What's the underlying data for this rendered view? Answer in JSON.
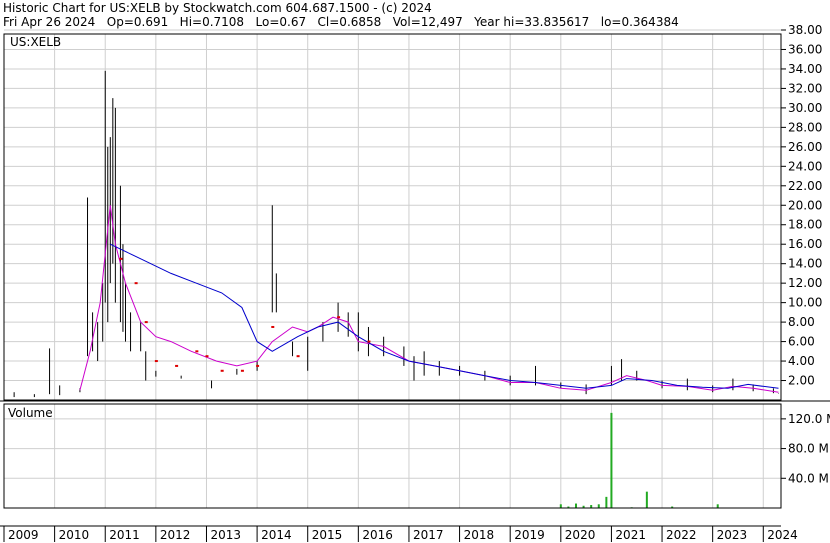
{
  "header": {
    "line1": "Historic Chart for US:XELB by Stockwatch.com 604.687.1500 - (c) 2024",
    "line2": "Fri Apr 26 2024   Op=0.691   Hi=0.7108   Lo=0.67   Cl=0.6858   Vol=12,497   Year hi=33.835617   lo=0.364384"
  },
  "colors": {
    "background": "#ffffff",
    "grid": "#cfcfcf",
    "price_bar": "#000000",
    "ma_short": "#cc00cc",
    "ma_long": "#0000cc",
    "red_marks": "#dd0000",
    "volume": "#22aa22"
  },
  "chart_data": [
    {
      "type": "line",
      "title": "US:XELB",
      "ylim": [
        0,
        38
      ],
      "yticks": [
        "38.00",
        "36.00",
        "34.00",
        "32.00",
        "30.00",
        "28.00",
        "26.00",
        "24.00",
        "22.00",
        "20.00",
        "18.00",
        "16.00",
        "14.00",
        "12.00",
        "10.00",
        "8.00",
        "6.00",
        "4.00",
        "2.00"
      ],
      "grid": true,
      "x_labels": [
        "2009",
        "2010",
        "2011",
        "2012",
        "2013",
        "2014",
        "2015",
        "2016",
        "2017",
        "2018",
        "2019",
        "2020",
        "2021",
        "2022",
        "2023",
        "2024"
      ],
      "price_bars": [
        {
          "x": 2009.2,
          "hi": 0.8,
          "lo": 0.3
        },
        {
          "x": 2009.6,
          "hi": 0.6,
          "lo": 0.3
        },
        {
          "x": 2009.9,
          "hi": 5.3,
          "lo": 0.6
        },
        {
          "x": 2010.1,
          "hi": 1.5,
          "lo": 0.5
        },
        {
          "x": 2010.5,
          "hi": 1.2,
          "lo": 0.8
        },
        {
          "x": 2010.65,
          "hi": 20.8,
          "lo": 4.5
        },
        {
          "x": 2010.75,
          "hi": 9.0,
          "lo": 5.0
        },
        {
          "x": 2010.85,
          "hi": 8.0,
          "lo": 4.0
        },
        {
          "x": 2010.95,
          "hi": 12.0,
          "lo": 6.0
        },
        {
          "x": 2011.0,
          "hi": 33.8,
          "lo": 10.0
        },
        {
          "x": 2011.05,
          "hi": 26.0,
          "lo": 8.0
        },
        {
          "x": 2011.1,
          "hi": 27.0,
          "lo": 12.0
        },
        {
          "x": 2011.15,
          "hi": 31.0,
          "lo": 14.0
        },
        {
          "x": 2011.2,
          "hi": 30.0,
          "lo": 10.0
        },
        {
          "x": 2011.3,
          "hi": 22.0,
          "lo": 8.0
        },
        {
          "x": 2011.35,
          "hi": 16.0,
          "lo": 7.0
        },
        {
          "x": 2011.4,
          "hi": 12.0,
          "lo": 6.0
        },
        {
          "x": 2011.5,
          "hi": 9.0,
          "lo": 5.0
        },
        {
          "x": 2011.7,
          "hi": 8.0,
          "lo": 5.0
        },
        {
          "x": 2011.8,
          "hi": 5.0,
          "lo": 2.0
        },
        {
          "x": 2012.0,
          "hi": 3.0,
          "lo": 2.4
        },
        {
          "x": 2012.5,
          "hi": 2.5,
          "lo": 2.2
        },
        {
          "x": 2013.1,
          "hi": 2.0,
          "lo": 1.2
        },
        {
          "x": 2013.6,
          "hi": 3.2,
          "lo": 2.6
        },
        {
          "x": 2014.0,
          "hi": 4.0,
          "lo": 3.0
        },
        {
          "x": 2014.3,
          "hi": 20.0,
          "lo": 9.0
        },
        {
          "x": 2014.38,
          "hi": 13.0,
          "lo": 9.0
        },
        {
          "x": 2014.7,
          "hi": 6.0,
          "lo": 4.5
        },
        {
          "x": 2015.0,
          "hi": 6.5,
          "lo": 3.0
        },
        {
          "x": 2015.3,
          "hi": 8.0,
          "lo": 6.0
        },
        {
          "x": 2015.6,
          "hi": 10.0,
          "lo": 7.0
        },
        {
          "x": 2015.8,
          "hi": 9.0,
          "lo": 6.5
        },
        {
          "x": 2016.0,
          "hi": 9.0,
          "lo": 5.0
        },
        {
          "x": 2016.2,
          "hi": 7.5,
          "lo": 4.5
        },
        {
          "x": 2016.5,
          "hi": 6.5,
          "lo": 4.5
        },
        {
          "x": 2016.9,
          "hi": 5.5,
          "lo": 3.5
        },
        {
          "x": 2017.1,
          "hi": 4.5,
          "lo": 2.0
        },
        {
          "x": 2017.3,
          "hi": 5.0,
          "lo": 2.5
        },
        {
          "x": 2017.6,
          "hi": 4.0,
          "lo": 2.5
        },
        {
          "x": 2018.0,
          "hi": 3.5,
          "lo": 2.5
        },
        {
          "x": 2018.5,
          "hi": 3.0,
          "lo": 2.0
        },
        {
          "x": 2019.0,
          "hi": 2.5,
          "lo": 1.5
        },
        {
          "x": 2019.5,
          "hi": 3.5,
          "lo": 1.5
        },
        {
          "x": 2020.0,
          "hi": 1.8,
          "lo": 1.2
        },
        {
          "x": 2020.5,
          "hi": 1.6,
          "lo": 0.6
        },
        {
          "x": 2021.0,
          "hi": 3.5,
          "lo": 1.5
        },
        {
          "x": 2021.2,
          "hi": 4.2,
          "lo": 2.0
        },
        {
          "x": 2021.5,
          "hi": 3.0,
          "lo": 2.0
        },
        {
          "x": 2022.0,
          "hi": 2.0,
          "lo": 1.2
        },
        {
          "x": 2022.5,
          "hi": 2.2,
          "lo": 1.0
        },
        {
          "x": 2023.0,
          "hi": 1.5,
          "lo": 0.8
        },
        {
          "x": 2023.4,
          "hi": 2.2,
          "lo": 1.0
        },
        {
          "x": 2023.8,
          "hi": 1.6,
          "lo": 0.9
        },
        {
          "x": 2024.2,
          "hi": 1.2,
          "lo": 0.7
        },
        {
          "x": 2024.3,
          "hi": 0.71,
          "lo": 0.67
        }
      ],
      "series": [
        {
          "x": [
            2010.5,
            2010.7,
            2010.9,
            2011.0,
            2011.1,
            2011.2,
            2011.4,
            2011.7,
            2012.0,
            2012.3,
            2012.7,
            2013.2,
            2013.6,
            2014.0,
            2014.3,
            2014.7,
            2015.0,
            2015.2,
            2015.5,
            2015.8,
            2016.0,
            2016.5,
            2017.0,
            2017.5,
            2018.0,
            2018.5,
            2019.0,
            2019.5,
            2020.0,
            2020.5,
            2021.0,
            2021.3,
            2021.7,
            2022.0,
            2022.5,
            2023.0,
            2023.4,
            2023.8,
            2024.3
          ],
          "y": [
            1.0,
            5.0,
            10.0,
            15.0,
            20.0,
            16.0,
            12.0,
            8.0,
            6.5,
            6.0,
            5.0,
            4.0,
            3.5,
            4.0,
            6.0,
            7.5,
            7.0,
            7.5,
            8.5,
            8.0,
            6.0,
            5.5,
            4.0,
            3.5,
            3.0,
            2.5,
            1.8,
            1.8,
            1.2,
            1.0,
            1.8,
            2.5,
            2.0,
            1.5,
            1.4,
            1.0,
            1.4,
            1.2,
            0.8
          ]
        },
        {
          "x": [
            2011.1,
            2011.3,
            2011.7,
            2012.3,
            2012.8,
            2013.3,
            2013.7,
            2014.0,
            2014.3,
            2014.8,
            2015.2,
            2015.6,
            2016.0,
            2016.5,
            2017.0,
            2017.5,
            2018.0,
            2018.5,
            2019.0,
            2019.5,
            2020.0,
            2020.5,
            2021.0,
            2021.3,
            2021.8,
            2022.3,
            2022.8,
            2023.3,
            2023.7,
            2024.3
          ],
          "y": [
            16.0,
            15.5,
            14.5,
            13.0,
            12.0,
            11.0,
            9.5,
            6.0,
            5.0,
            6.5,
            7.5,
            8.0,
            6.5,
            5.0,
            4.0,
            3.5,
            3.0,
            2.5,
            2.0,
            1.8,
            1.5,
            1.2,
            1.5,
            2.2,
            2.0,
            1.5,
            1.3,
            1.2,
            1.6,
            1.2
          ]
        }
      ],
      "red_marks": [
        {
          "x": 2011.3,
          "y": 14.5
        },
        {
          "x": 2011.6,
          "y": 12.0
        },
        {
          "x": 2011.8,
          "y": 8.0
        },
        {
          "x": 2012.0,
          "y": 4.0
        },
        {
          "x": 2012.4,
          "y": 3.5
        },
        {
          "x": 2012.8,
          "y": 5.0
        },
        {
          "x": 2013.0,
          "y": 4.5
        },
        {
          "x": 2013.3,
          "y": 3.0
        },
        {
          "x": 2013.7,
          "y": 3.0
        },
        {
          "x": 2014.0,
          "y": 3.5
        },
        {
          "x": 2014.3,
          "y": 7.5
        },
        {
          "x": 2014.8,
          "y": 4.5
        },
        {
          "x": 2015.6,
          "y": 8.5
        },
        {
          "x": 2016.2,
          "y": 6.0
        }
      ]
    },
    {
      "type": "bar",
      "title": "Volume",
      "ylim": [
        0,
        140
      ],
      "yticks": [
        "120.0 M",
        "80.0 M",
        "40.0 M"
      ],
      "grid": true,
      "x": [
        2020.0,
        2020.15,
        2020.3,
        2020.45,
        2020.6,
        2020.75,
        2020.9,
        2021.0,
        2021.4,
        2021.7,
        2022.2,
        2023.1
      ],
      "values": [
        5,
        2,
        6,
        3,
        4,
        5,
        15,
        128,
        1,
        22,
        2,
        5
      ]
    }
  ]
}
